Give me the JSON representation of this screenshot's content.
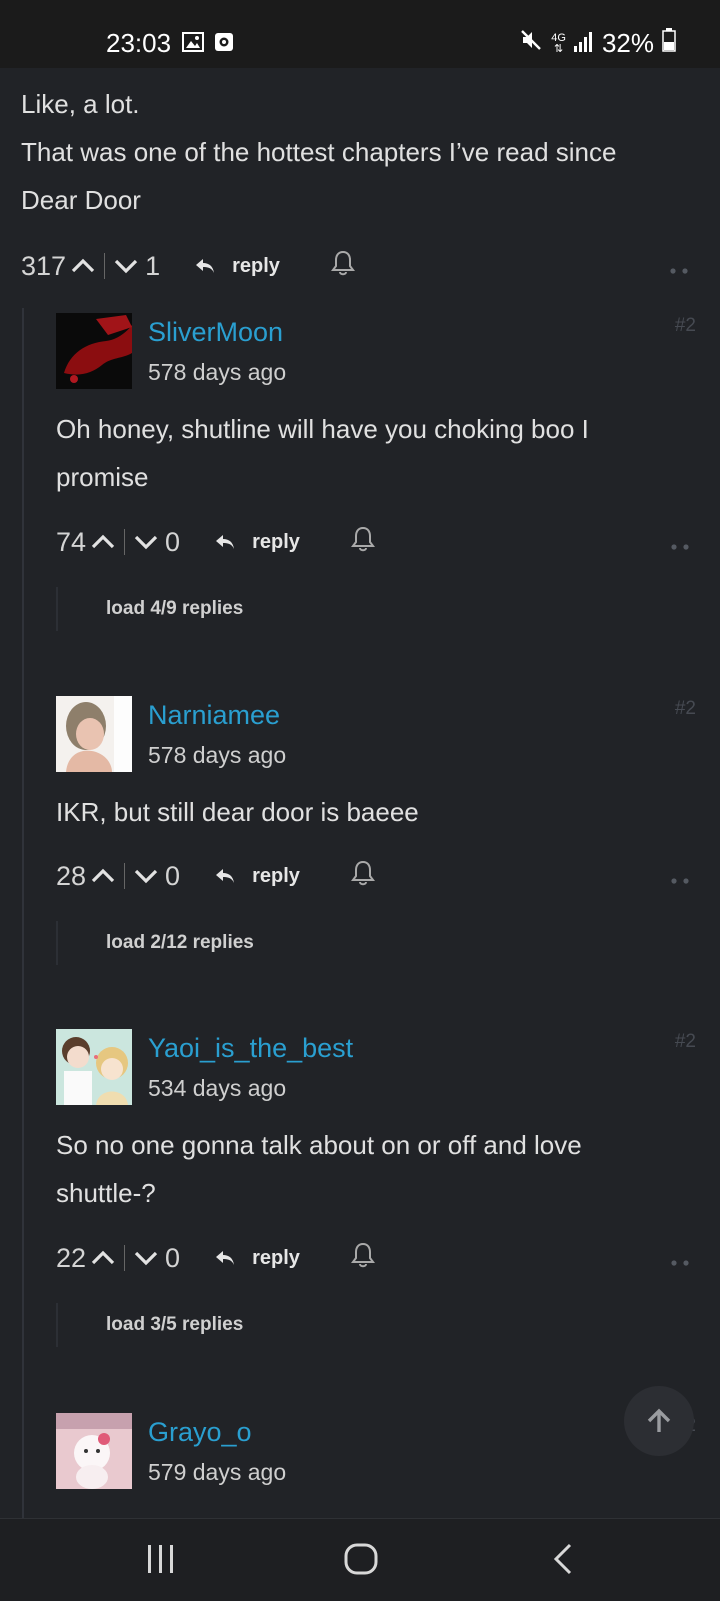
{
  "status_bar": {
    "time": "23:03",
    "battery": "32%",
    "network": "4G",
    "icons": [
      "gallery-icon",
      "screen-record-icon",
      "mute-icon",
      "data-arrows-icon",
      "signal-icon",
      "battery-icon"
    ]
  },
  "parent_comment": {
    "lines": [
      "Like, a lot.",
      "That was one of the hottest chapters I’ve read since",
      "Dear Door"
    ],
    "upvotes": "317",
    "downvotes": "1",
    "reply_label": "reply"
  },
  "comments": [
    {
      "username": "SliverMoon",
      "time_ago": "578 days ago",
      "number": "#2",
      "text": [
        "Oh honey, shutline will have you choking boo I",
        "promise"
      ],
      "upvotes": "74",
      "downvotes": "0",
      "reply_label": "reply",
      "load_replies": "load 4/9 replies",
      "avatar_color": "#8b0d10"
    },
    {
      "username": "Narniamee",
      "time_ago": "578 days ago",
      "number": "#2",
      "text": [
        "IKR, but still dear door is baeee"
      ],
      "upvotes": "28",
      "downvotes": "0",
      "reply_label": "reply",
      "load_replies": "load 2/12 replies",
      "avatar_color": "#caa48f"
    },
    {
      "username": "Yaoi_is_the_best",
      "time_ago": "534 days ago",
      "number": "#2",
      "text": [
        "So no one gonna talk about on or off and love",
        "shuttle-?"
      ],
      "upvotes": "22",
      "downvotes": "0",
      "reply_label": "reply",
      "load_replies": "load 3/5 replies",
      "avatar_color": "#cbe6de"
    },
    {
      "username": "Grayo_o",
      "time_ago": "579 days ago",
      "number": "#2",
      "avatar_color": "#e9c9cf"
    }
  ],
  "colors": {
    "background": "#212327",
    "username": "#2a9fd0",
    "status_bar": "#1b1b1b",
    "nav_bar": "#1e1f22"
  },
  "nav": {
    "icons": [
      "recent-apps-icon",
      "home-icon",
      "back-icon"
    ]
  }
}
